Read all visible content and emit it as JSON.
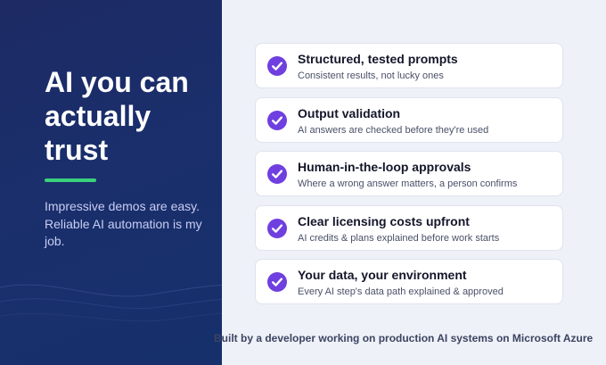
{
  "headline": "AI you can actually trust",
  "subtext": "Impressive demos are easy. Reliable AI automation is my job.",
  "features": [
    {
      "title": "Structured, tested prompts",
      "description": "Consistent results, not lucky ones"
    },
    {
      "title": "Output validation",
      "description": "AI answers are checked before they're used"
    },
    {
      "title": "Human-in-the-loop approvals",
      "description": "Where a wrong answer matters, a person confirms"
    },
    {
      "title": "Clear licensing costs upfront",
      "description": "AI credits & plans explained before work starts"
    },
    {
      "title": "Your data, your environment",
      "description": "Every AI step's data path explained & approved"
    }
  ],
  "footer": "Built by a developer working on production AI systems on Microsoft Azure",
  "colors": {
    "left_panel": "#1d2a63",
    "accent": "#3ad17a",
    "check": "#6f3fe0",
    "background": "#eef1f7"
  },
  "icons": {
    "feature_icon": "check-circle-icon"
  }
}
